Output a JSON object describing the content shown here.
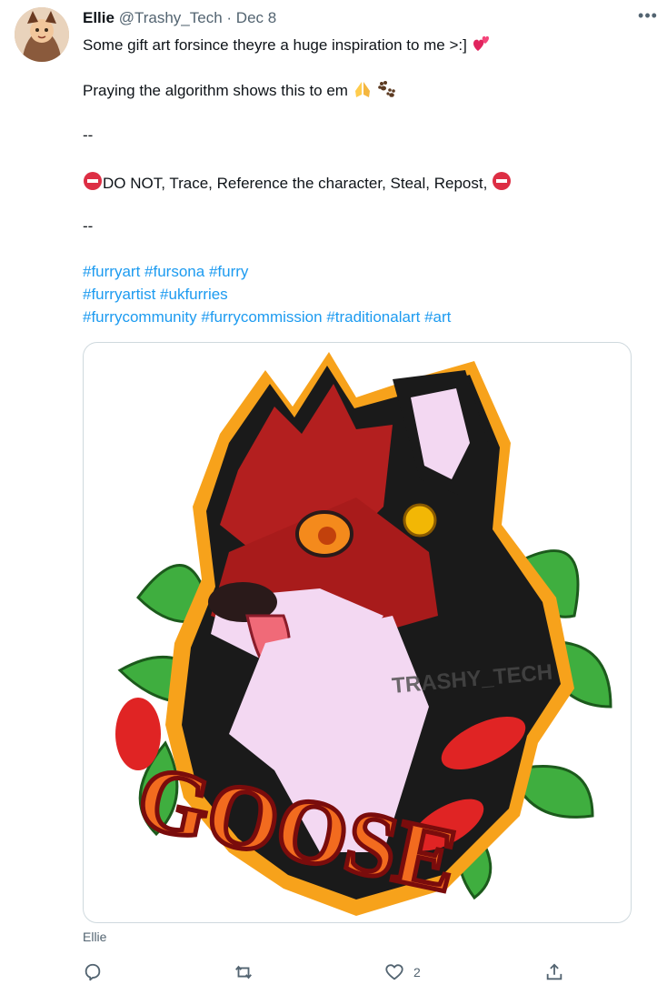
{
  "tweet": {
    "author_name": "Ellie",
    "handle": "@Trashy_Tech",
    "separator": "·",
    "date": "Dec 8",
    "more_label": "•••",
    "line1": "Some gift art forsince theyre a huge inspiration to me >:]",
    "line2": "Praying the algorithm shows this to em",
    "divider1": "--",
    "warning": "DO NOT, Trace, Reference the character, Steal, Repost,",
    "divider2": "--",
    "hashtags_line1": [
      "#furryart",
      "#fursona",
      "#furry"
    ],
    "hashtags_line2": [
      "#furryartist",
      "#ukfurries"
    ],
    "hashtags_line3": [
      "#furrycommunity",
      "#furrycommission",
      "#traditionalart",
      "#art"
    ],
    "image_text": "GOOSE",
    "watermark": "TRASHY_TECH",
    "image_credit": "Ellie",
    "actions": {
      "reply_count": "",
      "retweet_count": "",
      "like_count": "2",
      "share_count": ""
    }
  },
  "colors": {
    "link": "#1d9bf0",
    "muted": "#536471",
    "border": "#cfd9de"
  },
  "icons": [
    "reply-icon",
    "retweet-icon",
    "like-icon",
    "share-icon",
    "more-icon",
    "sparkling-heart-emoji",
    "praying-hands-emoji",
    "paw-prints-emoji",
    "no-entry-emoji"
  ]
}
